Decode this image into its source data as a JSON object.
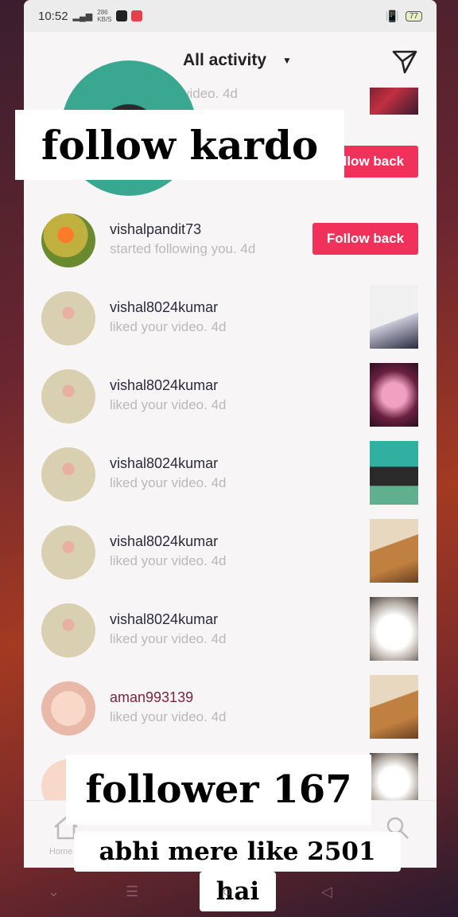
{
  "status_bar": {
    "time": "10:52",
    "network_speed": "286\nKB/S",
    "battery": "77"
  },
  "header": {
    "title": "All activity"
  },
  "partial_top_row": {
    "action": "video. 4d"
  },
  "partial_follow_row": {
    "button": "Follow back"
  },
  "rows": [
    {
      "username": "vishalpandit73",
      "action": "started following you. 4d",
      "button": "Follow back"
    },
    {
      "username": "vishal8024kumar",
      "action": "liked your video. 4d"
    },
    {
      "username": "vishal8024kumar",
      "action": "liked your video. 4d"
    },
    {
      "username": "vishal8024kumar",
      "action": "liked your video. 4d"
    },
    {
      "username": "vishal8024kumar",
      "action": "liked your video. 4d"
    },
    {
      "username": "vishal8024kumar",
      "action": "liked your video. 4d"
    },
    {
      "username": "aman993139",
      "action": "liked your video. 4d"
    }
  ],
  "bottom_nav": {
    "home_label": "Home"
  },
  "captions": {
    "follow": "follow kardo",
    "followers": "follower 167",
    "likes": "abhi mere like 2501",
    "hai": "hai"
  },
  "colors": {
    "accent": "#f0325a",
    "screen_bg": "#f7f5f5",
    "secondary_text": "#b9b9b9"
  }
}
